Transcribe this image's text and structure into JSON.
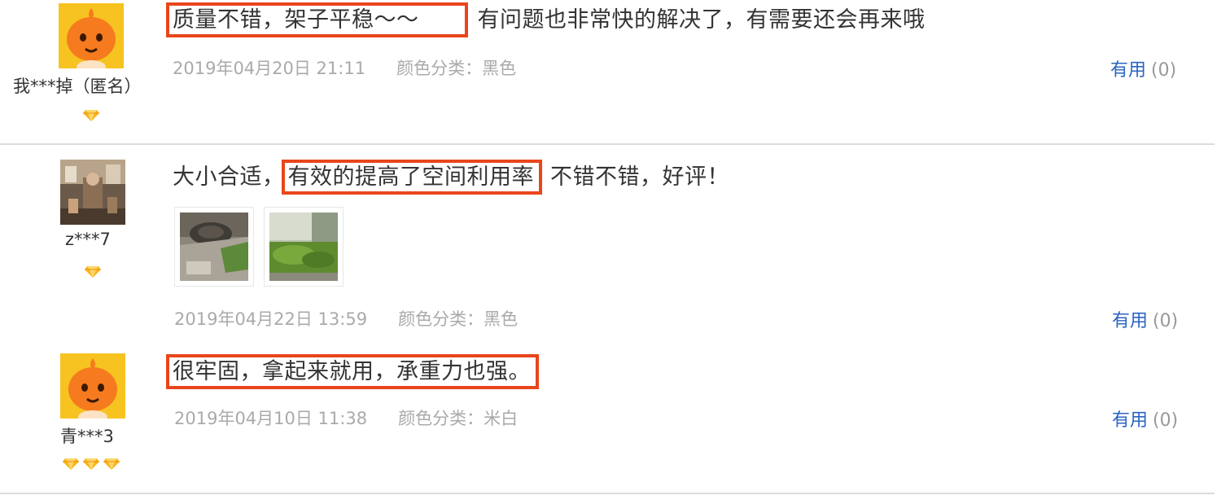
{
  "reviews": [
    {
      "user": "我***掉（匿名）",
      "level": 1,
      "highlight": "质量不错，架子平稳～～",
      "text": "有问题也非常快的解决了，有需要还会再来哦",
      "date": "2019年04月20日 21:11",
      "spec": "颜色分类：黑色",
      "useful_label": "有用",
      "useful_count": "(0)"
    },
    {
      "user": "z***7",
      "level": 1,
      "text_before": "大小合适，",
      "highlight": "有效的提高了空间利用率",
      "text": "不错不错，好评！",
      "photos": [
        "review-photo-1",
        "review-photo-2"
      ],
      "date": "2019年04月22日 13:59",
      "spec": "颜色分类：黑色",
      "useful_label": "有用",
      "useful_count": "(0)"
    },
    {
      "user": "青***3",
      "level": 3,
      "highlight": "很牢固，拿起来就用，承重力也强。",
      "date": "2019年04月10日 11:38",
      "spec": "颜色分类：米白",
      "useful_label": "有用",
      "useful_count": "(0)"
    }
  ],
  "colors": {
    "highlight_border": "#e8461c",
    "link_blue": "#2a64c5",
    "meta_gray": "#aaaaaa",
    "avatar_orange": "#f7a21b"
  }
}
